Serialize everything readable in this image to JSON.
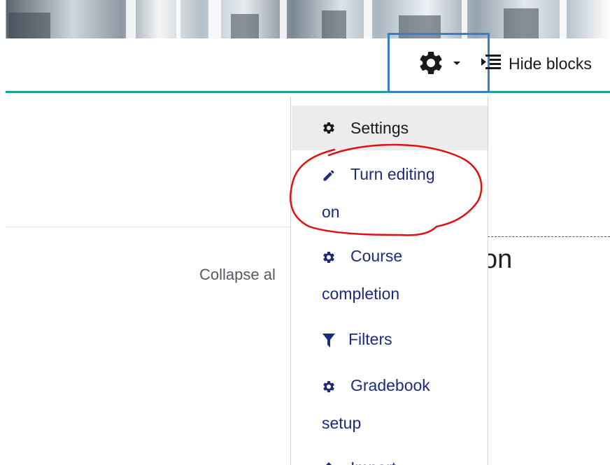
{
  "header": {
    "hide_blocks_label": "Hide blocks"
  },
  "page": {
    "collapse_label": "Collapse al",
    "section_heading_fragment": "on"
  },
  "menu": {
    "items": [
      {
        "label": "Settings",
        "label_wrap": "",
        "icon": "gear-icon",
        "active": true
      },
      {
        "label": "Turn editing",
        "label_wrap": "on",
        "icon": "pencil-icon",
        "active": false
      },
      {
        "label": "Course",
        "label_wrap": "completion",
        "icon": "gear-icon",
        "active": false
      },
      {
        "label": "Filters",
        "label_wrap": "",
        "icon": "filter-icon",
        "active": false
      },
      {
        "label": "Gradebook",
        "label_wrap": "setup",
        "icon": "gear-icon",
        "active": false
      },
      {
        "label": "Import",
        "label_wrap": "",
        "icon": "upload-icon",
        "active": false
      }
    ]
  },
  "colors": {
    "accent_line": "#1aa39a",
    "menu_link": "#1d2b7a",
    "highlight_box": "#3a7fc1",
    "annotation_circle": "#e01010"
  }
}
